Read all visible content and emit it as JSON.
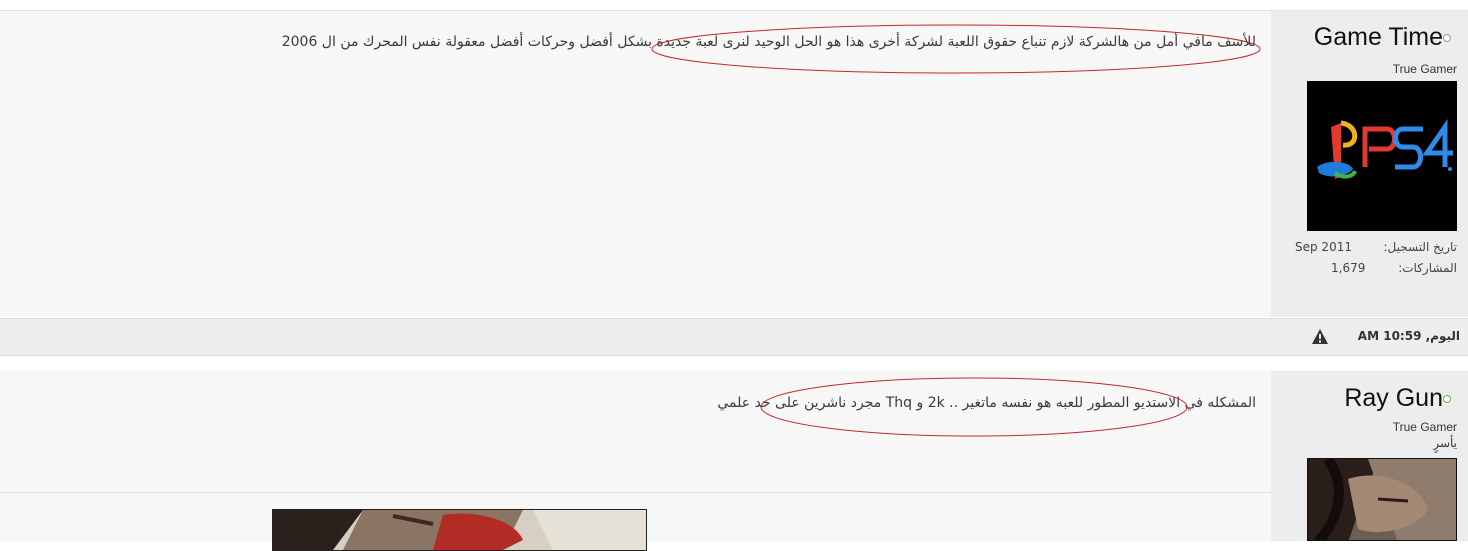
{
  "posts": [
    {
      "username": "Game Time",
      "status": "offline",
      "user_title": "True Gamer",
      "avatar_icon": "ps4-logo-avatar",
      "join_label": "تاريخ التسجيل:",
      "join_value": "Sep 2011",
      "posts_label": "المشاركات:",
      "posts_value": "1,679",
      "text": "للأسف مافي أمل من هالشركة لازم تنباع حقوق اللعبة لشركة أخرى هذا هو الحل الوحيد لنرى لعبة جديدة بشكل أفضل وحركات أفضل معقولة نفس المحرك من ال 2006"
    },
    {
      "username": "Ray Gun",
      "status": "online",
      "user_title": "True Gamer",
      "user_subtitle": "يأسرٍ",
      "avatar_icon": "character-portrait-avatar",
      "text": "المشكله في الاستديو المطور للعبه هو نفسه ماتغير .. 2k و Thq مجرد ناشرين على حد علمي",
      "signature_icon": "character-art-signature"
    }
  ],
  "date_bar": {
    "text": "اليوم, 10:59 AM",
    "report_icon": "warning-icon"
  },
  "colors": {
    "annotation_ellipse": "#c0282d",
    "online": "#6ab04c",
    "offline": "#9a9a9a"
  }
}
